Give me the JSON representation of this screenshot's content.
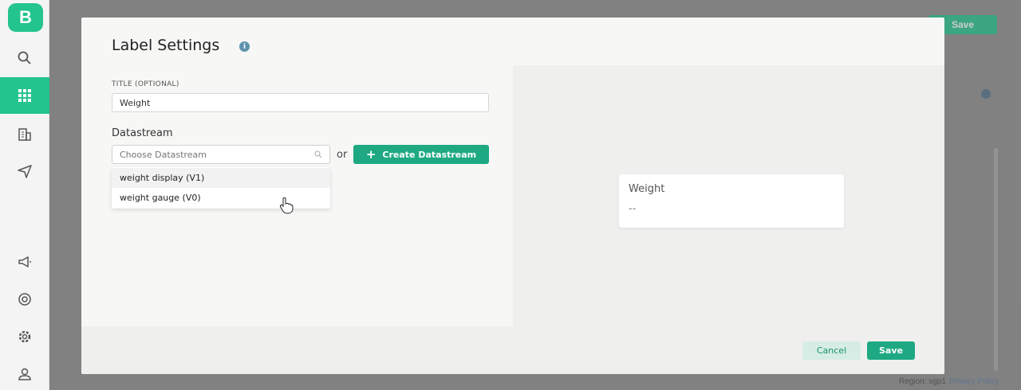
{
  "app": {
    "logo_letter": "B",
    "header_save_label": "Save",
    "footer": {
      "region": "Region: sgp1",
      "privacy": "Privacy Policy"
    }
  },
  "sidebar": {
    "items": [
      {
        "icon": "search-icon"
      },
      {
        "icon": "grid-icon",
        "active": true
      },
      {
        "icon": "building-icon"
      },
      {
        "icon": "send-icon"
      },
      {
        "icon": "megaphone-icon"
      },
      {
        "icon": "lifebuoy-icon"
      },
      {
        "icon": "gear-icon"
      },
      {
        "icon": "user-icon"
      }
    ]
  },
  "modal": {
    "title": "Label Settings",
    "title_field": {
      "label": "TITLE (OPTIONAL)",
      "value": "Weight"
    },
    "datastream": {
      "label": "Datastream",
      "placeholder": "Choose Datastream",
      "or_text": "or",
      "create_label": "Create Datastream",
      "options": [
        "weight display (V1)",
        "weight gauge (V0)"
      ]
    },
    "preview": {
      "title": "Weight",
      "value": "--"
    },
    "cancel_label": "Cancel",
    "save_label": "Save"
  },
  "colors": {
    "accent": "#1ea983",
    "brand": "#23c48e"
  }
}
